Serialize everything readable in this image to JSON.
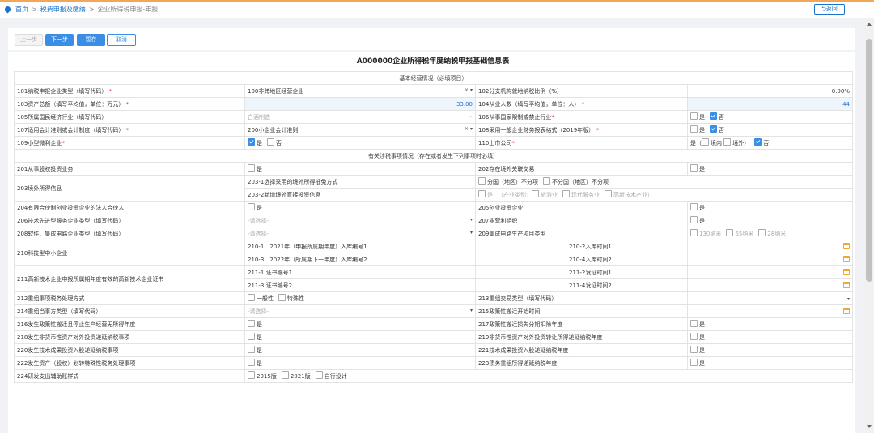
{
  "breadcrumb": {
    "home": "首页",
    "item1": "税费申报及缴纳",
    "item2": "企业所得税申报-年报",
    "back": "返回"
  },
  "toolbar": {
    "prev": "上一步",
    "next": "下一步",
    "save": "暂存",
    "cancel": "取消"
  },
  "form": {
    "title": "A000000企业所得税年度纳税申报基础信息表",
    "section1": "基本经营情况（必填项目）",
    "section2": "有关涉税事项情况（存在或者发生下列事项时必填）",
    "r101_label": "101纳税申报企业类型（填写代码）",
    "r101_value": "100非跨地区经营企业",
    "r102_label": "102分支机构就地纳税比例（%）",
    "r102_value": "0.00%",
    "r103_label": "103资产总额（填写平均值，单位：万元）",
    "r103_value": "33.00",
    "r104_label": "104从业人数（填写平均值，单位：人）",
    "r104_value": "44",
    "r105_label": "105所属国民经济行业（填写代码）",
    "r105_value": "白酒制造",
    "r106_label": "106从事国家限制或禁止行业",
    "r107_label": "107适用会计准则或会计制度（填写代码）",
    "r107_value": "200小企业会计准则",
    "r108_label": "108采用一般企业财务报表格式（2019年版）",
    "r109_label": "109小型微利企业",
    "r110_label": "110上市公司",
    "yes": "是",
    "no": "否",
    "r110_open": "是（",
    "r110_in": "境内",
    "r110_out": "境外）",
    "r201_label": "201从事股权投资业务",
    "r202_label": "202存在境外关联交易",
    "r203_label": "203境外所得信息",
    "r203_1_label": "203-1选择采用的境外所得抵免方式",
    "r203_1_opt1": "分国（地区）不分项",
    "r203_1_opt2": "不分国（地区）不分项",
    "r203_2_label": "203-2新增境外直接投资信息",
    "r203_2_opt_yes": "是",
    "r203_2_cat": "（产业类别：",
    "r203_2_opt1": "旅游业",
    "r203_2_opt2": "现代服务业",
    "r203_2_opt3": "高新技术产业",
    "r203_2_close": "）",
    "r204_label": "204有限合伙制创业投资企业的法人合伙人",
    "r205_label": "205创业投资企业",
    "r206_label": "206技术先进型服务企业类型（填写代码）",
    "placeholder": "-请选择-",
    "r207_label": "207非营利组织",
    "r208_label": "208软件、集成电路企业类型（填写代码）",
    "r209_label": "209集成电路生产项目类型",
    "r209_opt1": "130纳米",
    "r209_opt2": "65纳米",
    "r209_opt3": "28纳米",
    "r210_label": "210科技型中小企业",
    "r210_1": "210-1　2021年（申报所属期年度）入库编号1",
    "r210_2": "210-2入库时间1",
    "r210_3": "210-3　2022年（所属期下一年度）入库编号2",
    "r210_4": "210-4入库时间2",
    "r211_label": "211高新技术企业申报所属期年度有效的高新技术企业证书",
    "r211_1": "211-1 证书编号1",
    "r211_2": "211-2发证时间1",
    "r211_3": "211-3 证书编号2",
    "r211_4": "211-4发证时间2",
    "r212_label": "212重组事项税务处理方式",
    "r212_opt1": "一般性",
    "r212_opt2": "特殊性",
    "r213_label": "213重组交易类型（填写代码）",
    "r214_label": "214重组当事方类型（填写代码）",
    "r215_label": "215政策性搬迁开始时间",
    "r216_label": "216发生政策性搬迁且停止生产经营无所得年度",
    "r217_label": "217政策性搬迁损失分期扣除年度",
    "r218_label": "218发生非货币性资产对外投资递延纳税事项",
    "r219_label": "219非货币性资产对外投资转让所得递延纳税年度",
    "r220_label": "220发生技术成果投资入股递延纳税事项",
    "r221_label": "221技术成果投资入股递延纳税年度",
    "r222_label": "222发生资产（股权）划转特殊性税务处理事项",
    "r223_label": "223债务重组所得递延纳税年度",
    "r224_label": "224研发支出辅助账样式",
    "r224_opt1": "2015版",
    "r224_opt2": "2021版",
    "r224_opt3": "自行设计"
  }
}
